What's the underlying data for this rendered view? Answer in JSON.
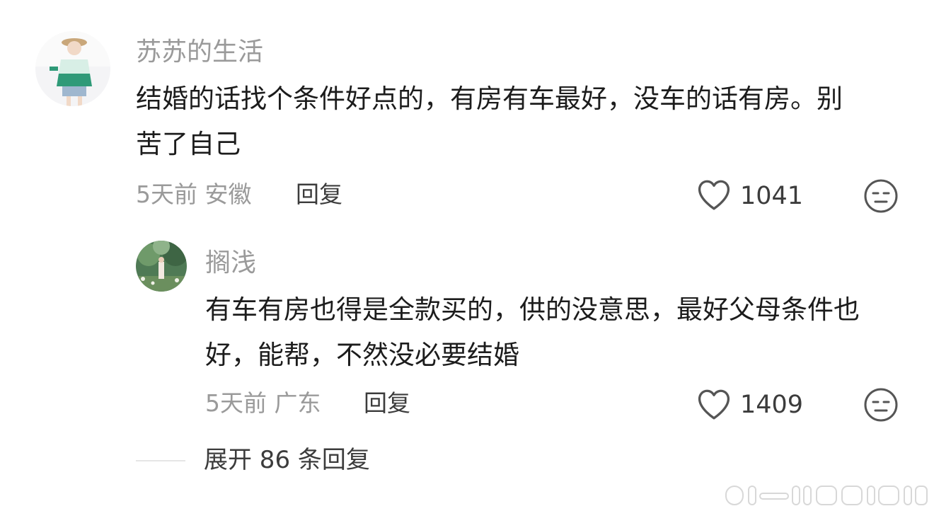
{
  "comments": [
    {
      "username": "苏苏的生活",
      "content": "结婚的话找个条件好点的，有房有车最好，没车的话有房。别苦了自己",
      "time": "5天前",
      "location": "安徽",
      "reply_label": "回复",
      "likes": "1041",
      "replies": [
        {
          "username": "搁浅",
          "content": "有车有房也得是全款买的，供的没意思，最好父母条件也好，能帮，不然没必要结婚",
          "time": "5天前",
          "location": "广东",
          "reply_label": "回复",
          "likes": "1409"
        }
      ],
      "expand_label": "展开 86 条回复"
    }
  ]
}
